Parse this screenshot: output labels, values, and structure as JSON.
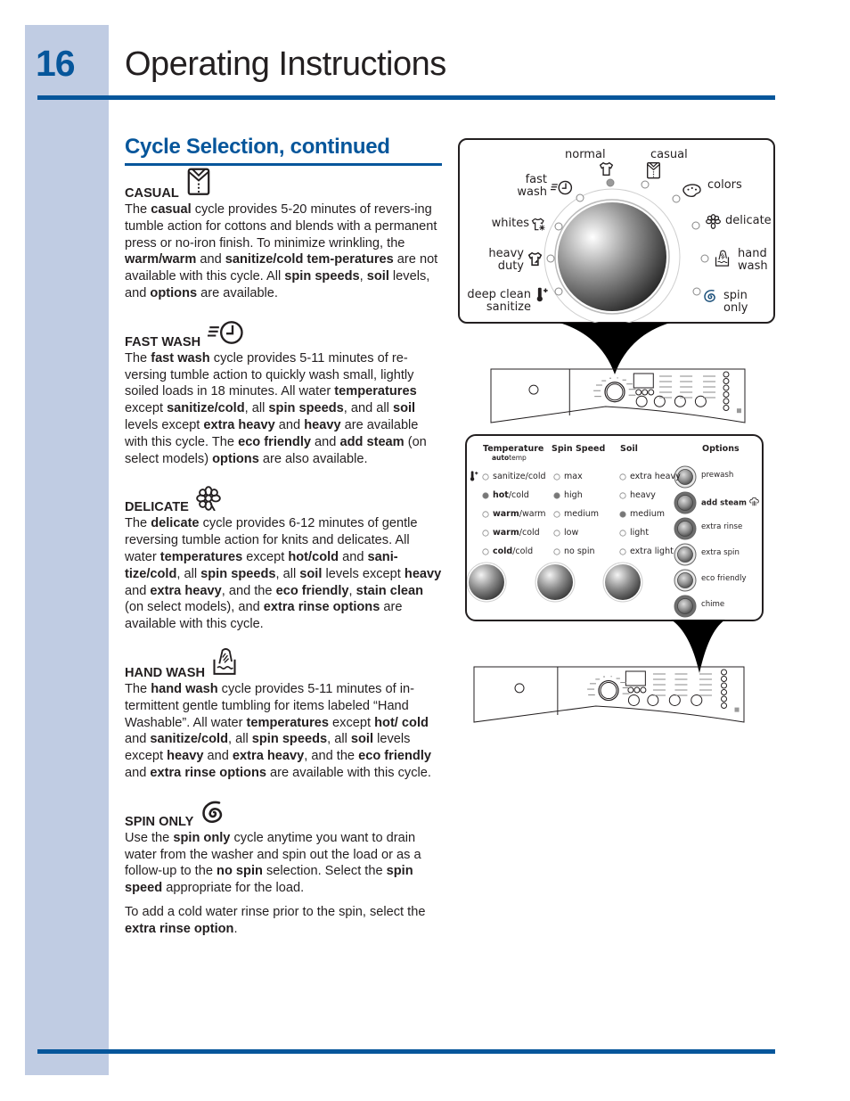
{
  "page": {
    "number": "16",
    "title": "Operating Instructions",
    "section_title": "Cycle Selection, continued",
    "accent_color": "#06569b",
    "band_color": "#c0cce3"
  },
  "cycles": [
    {
      "name": "CASUAL",
      "icon": "casual-shirt-icon",
      "paragraphs": [
        [
          {
            "t": "The "
          },
          {
            "t": "casual",
            "b": true
          },
          {
            "t": " cycle provides 5-20 minutes of revers-ing tumble action for cottons and blends with a permanent press or no-iron finish. To minimize wrinkling, the "
          },
          {
            "t": "warm/warm",
            "b": true
          },
          {
            "t": " and "
          },
          {
            "t": "sanitize/cold tem-peratures",
            "b": true
          },
          {
            "t": " are not available with this cycle. All "
          },
          {
            "t": "spin speeds",
            "b": true
          },
          {
            "t": ", "
          },
          {
            "t": "soil",
            "b": true
          },
          {
            "t": " levels, and "
          },
          {
            "t": "options",
            "b": true
          },
          {
            "t": " are available."
          }
        ]
      ]
    },
    {
      "name": "FAST WASH",
      "icon": "fast-wash-clock-icon",
      "paragraphs": [
        [
          {
            "t": "The "
          },
          {
            "t": "fast wash",
            "b": true
          },
          {
            "t": " cycle provides 5-11 minutes of re-versing tumble action to quickly wash small, lightly soiled loads in 18 minutes. All water "
          },
          {
            "t": "temperatures",
            "b": true
          },
          {
            "t": " except "
          },
          {
            "t": "sanitize/cold",
            "b": true
          },
          {
            "t": ", all "
          },
          {
            "t": "spin speeds",
            "b": true
          },
          {
            "t": ", and all "
          },
          {
            "t": "soil",
            "b": true
          },
          {
            "t": " levels except "
          },
          {
            "t": "extra heavy",
            "b": true
          },
          {
            "t": " and "
          },
          {
            "t": "heavy",
            "b": true
          },
          {
            "t": " are available with this cycle. The "
          },
          {
            "t": "eco friendly",
            "b": true
          },
          {
            "t": " and "
          },
          {
            "t": "add steam",
            "b": true
          },
          {
            "t": " (on select models) "
          },
          {
            "t": "options",
            "b": true
          },
          {
            "t": " are also available."
          }
        ]
      ]
    },
    {
      "name": "DELICATE",
      "icon": "delicate-flower-icon",
      "paragraphs": [
        [
          {
            "t": "The "
          },
          {
            "t": "delicate",
            "b": true
          },
          {
            "t": " cycle provides 6-12 minutes of gentle reversing tumble action for knits and delicates. All water "
          },
          {
            "t": "temperatures",
            "b": true
          },
          {
            "t": " except "
          },
          {
            "t": "hot/cold",
            "b": true
          },
          {
            "t": " and "
          },
          {
            "t": "sani-tize/cold",
            "b": true
          },
          {
            "t": ", all "
          },
          {
            "t": "spin speeds",
            "b": true
          },
          {
            "t": ", all "
          },
          {
            "t": "soil",
            "b": true
          },
          {
            "t": " levels except "
          },
          {
            "t": "heavy",
            "b": true
          },
          {
            "t": " and "
          },
          {
            "t": "extra heavy",
            "b": true
          },
          {
            "t": ", and the "
          },
          {
            "t": "eco friendly",
            "b": true
          },
          {
            "t": ", "
          },
          {
            "t": "stain clean",
            "b": true
          },
          {
            "t": " (on select models), and "
          },
          {
            "t": "extra rinse options",
            "b": true
          },
          {
            "t": " are available with this cycle."
          }
        ]
      ]
    },
    {
      "name": "HAND WASH",
      "icon": "hand-wash-basin-icon",
      "paragraphs": [
        [
          {
            "t": "The "
          },
          {
            "t": "hand wash",
            "b": true
          },
          {
            "t": " cycle provides 5-11 minutes of in-termittent gentle tumbling for items labeled “Hand Washable”. All water "
          },
          {
            "t": "temperatures",
            "b": true
          },
          {
            "t": " except "
          },
          {
            "t": "hot/ cold",
            "b": true
          },
          {
            "t": " and "
          },
          {
            "t": "sanitize/cold",
            "b": true
          },
          {
            "t": ", all "
          },
          {
            "t": "spin speeds",
            "b": true
          },
          {
            "t": ", all "
          },
          {
            "t": "soil",
            "b": true
          },
          {
            "t": " levels except "
          },
          {
            "t": "heavy",
            "b": true
          },
          {
            "t": " and "
          },
          {
            "t": "extra heavy",
            "b": true
          },
          {
            "t": ", and the "
          },
          {
            "t": "eco friendly",
            "b": true
          },
          {
            "t": " and "
          },
          {
            "t": "extra rinse options",
            "b": true
          },
          {
            "t": " are available with this cycle."
          }
        ]
      ]
    },
    {
      "name": "SPIN ONLY",
      "icon": "spin-spiral-icon",
      "paragraphs": [
        [
          {
            "t": "Use the "
          },
          {
            "t": "spin only",
            "b": true
          },
          {
            "t": " cycle anytime you want to drain water from the washer and spin out the load or as a follow-up to the "
          },
          {
            "t": "no spin",
            "b": true
          },
          {
            "t": " selection. Select the "
          },
          {
            "t": "spin speed",
            "b": true
          },
          {
            "t": " appropriate for the load."
          }
        ],
        [
          {
            "t": "To add a cold water rinse prior to the spin, select the "
          },
          {
            "t": "extra rinse option",
            "b": true
          },
          {
            "t": "."
          }
        ]
      ]
    }
  ],
  "dial": {
    "selected": "normal",
    "cycles": [
      {
        "id": "normal",
        "label": "normal",
        "icon": "t-shirt-icon",
        "selected": true
      },
      {
        "id": "casual",
        "label": "casual",
        "icon": "casual-shirt-icon",
        "selected": false
      },
      {
        "id": "colors",
        "label": "colors",
        "icon": "palette-icon",
        "selected": false
      },
      {
        "id": "delicate",
        "label": "delicate",
        "icon": "flower-icon",
        "selected": false
      },
      {
        "id": "hand-wash",
        "label": "hand\nwash",
        "icon": "hand-wash-basin-icon",
        "selected": false
      },
      {
        "id": "spin-only",
        "label": "spin\nonly",
        "icon": "spin-spiral-icon",
        "selected": false
      },
      {
        "id": "deep-clean-sanitize",
        "label": "deep clean\nsanitize",
        "icon": "thermometer-plus-icon",
        "selected": false
      },
      {
        "id": "heavy-duty",
        "label": "heavy\nduty",
        "icon": "heavy-shirt-icon",
        "selected": false
      },
      {
        "id": "whites",
        "label": "whites",
        "icon": "sparkle-shirt-icon",
        "selected": false
      },
      {
        "id": "fast-wash",
        "label": "fast\nwash",
        "icon": "fast-wash-clock-icon",
        "selected": false
      }
    ]
  },
  "options_panel": {
    "columns": [
      {
        "id": "temperature",
        "header": "Temperature",
        "subheader": {
          "bold": "auto",
          "normal": "temp"
        },
        "items": [
          {
            "bold": "",
            "normal": "sanitize/cold",
            "selected": false,
            "icon": "thermometer-plus-icon"
          },
          {
            "bold": "hot",
            "normal": "/cold",
            "selected": true
          },
          {
            "bold": "warm",
            "normal": "/warm",
            "selected": false
          },
          {
            "bold": "warm",
            "normal": "/cold",
            "selected": false
          },
          {
            "bold": "cold",
            "normal": "/cold",
            "selected": false
          }
        ]
      },
      {
        "id": "spin-speed",
        "header": "Spin Speed",
        "items": [
          {
            "bold": "",
            "normal": "max",
            "selected": false
          },
          {
            "bold": "",
            "normal": "high",
            "selected": true
          },
          {
            "bold": "",
            "normal": "medium",
            "selected": false
          },
          {
            "bold": "",
            "normal": "low",
            "selected": false
          },
          {
            "bold": "",
            "normal": "no spin",
            "selected": false
          }
        ]
      },
      {
        "id": "soil",
        "header": "Soil",
        "items": [
          {
            "bold": "",
            "normal": "extra heavy",
            "selected": false
          },
          {
            "bold": "",
            "normal": "heavy",
            "selected": false
          },
          {
            "bold": "",
            "normal": "medium",
            "selected": true
          },
          {
            "bold": "",
            "normal": "light",
            "selected": false
          },
          {
            "bold": "",
            "normal": "extra light",
            "selected": false
          }
        ]
      }
    ],
    "options_header": "Options",
    "options": [
      {
        "label": "prewash",
        "bold": false,
        "active": false
      },
      {
        "label": "add steam",
        "bold": true,
        "active": true,
        "icon": "steam-icon"
      },
      {
        "label": "extra rinse",
        "bold": false,
        "active": true
      },
      {
        "label": "extra spin",
        "bold": false,
        "active": false
      },
      {
        "label": "eco friendly",
        "bold": false,
        "active": false
      },
      {
        "label": "chime",
        "bold": false,
        "active": true
      }
    ]
  }
}
